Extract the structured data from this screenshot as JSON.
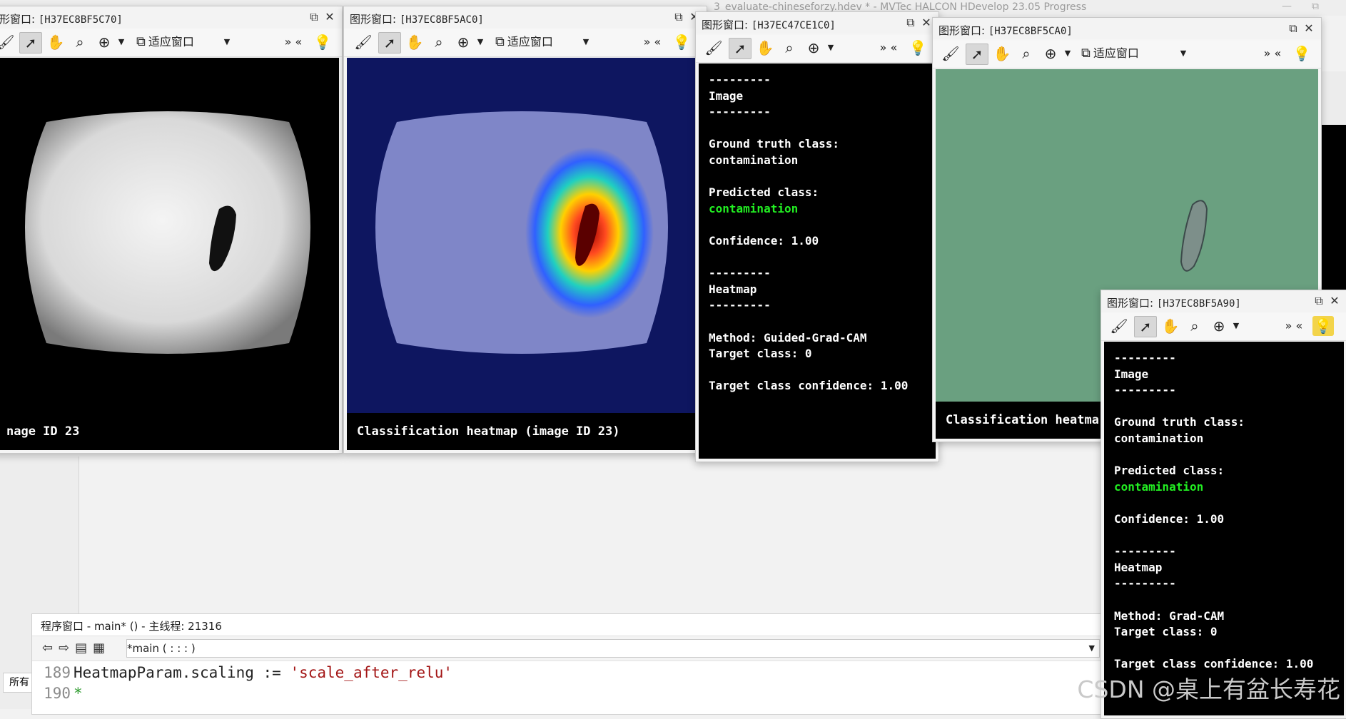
{
  "app": {
    "title": "3_evaluate-chineseforzy.hdev * - MVTec HALCON HDevelop 23.05 Progress"
  },
  "toolbar": {
    "fit_label": "适应窗口",
    "more": "» «"
  },
  "windows": [
    {
      "title_prefix": "形窗口:",
      "handle": "[H37EC8BF5C70]",
      "caption": "nage ID 23"
    },
    {
      "title_prefix": "图形窗口:",
      "handle": "[H37EC8BF5AC0]",
      "caption": "Classification heatmap (image ID 23)"
    },
    {
      "title_prefix": "图形窗口:",
      "handle": "[H37EC47CE1C0]"
    },
    {
      "title_prefix": "图形窗口:",
      "handle": "[H37EC8BF5CA0]",
      "caption": "Classification heatma"
    },
    {
      "title_prefix": "图形窗口:",
      "handle": "[H37EC8BF5A90]"
    }
  ],
  "info_a": {
    "sep1": "---------",
    "image_h": "Image",
    "sep2": "---------",
    "gt_label": "Ground truth class:",
    "gt_value": "contamination",
    "pred_label": "Predicted class:",
    "pred_value": "contamination",
    "conf": "Confidence: 1.00",
    "sep3": "---------",
    "heat_h": "Heatmap",
    "sep4": "---------",
    "method": "Method: Guided-Grad-CAM",
    "target": "Target class: 0",
    "tconf": "Target class confidence: 1.00"
  },
  "info_b": {
    "sep1": "---------",
    "image_h": "Image",
    "sep2": "---------",
    "gt_label": "Ground truth class:",
    "gt_value": "contamination",
    "pred_label": "Predicted class:",
    "pred_value": "contamination",
    "conf": "Confidence: 1.00",
    "sep3": "---------",
    "heat_h": "Heatmap",
    "sep4": "---------",
    "method": "Method: Grad-CAM",
    "target": "Target class: 0",
    "tconf": "Target class confidence: 1.00"
  },
  "program": {
    "title": "程序窗口 - main* () - 主线程: 21316",
    "proc_select": "*main ( : : : )",
    "lines": [
      {
        "no": "189",
        "code_id": "HeatmapParam.scaling := ",
        "code_str": "'scale_after_relu'"
      },
      {
        "no": "190",
        "code_star": "*"
      }
    ]
  },
  "sidebar": {
    "label": "所有"
  },
  "watermark": "CSDN @桌上有盆长寿花",
  "colors": {
    "accent_green": "#22ee22",
    "heatmap_bg": "#0e1660",
    "gradcam_bg": "#6aa080"
  }
}
